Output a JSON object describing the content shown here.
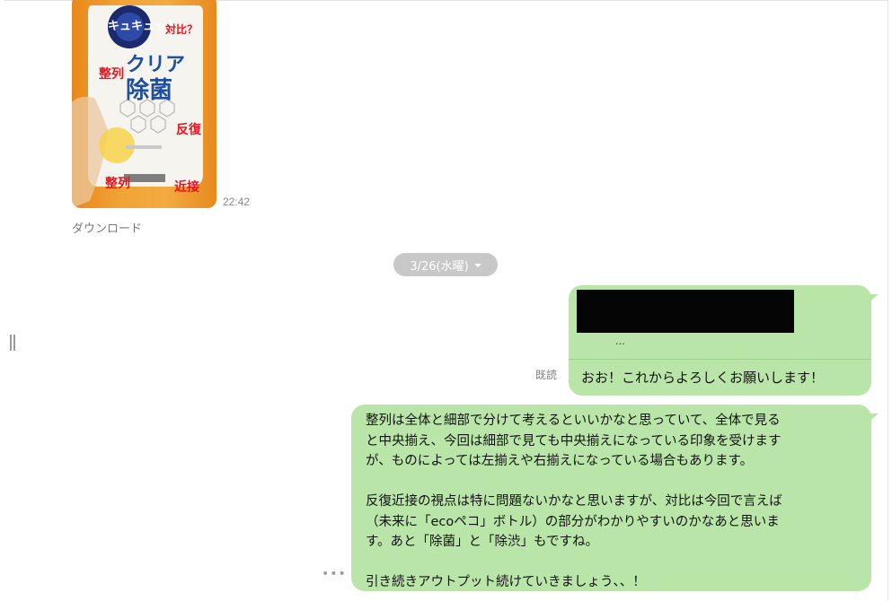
{
  "image_message": {
    "time": "22:42",
    "download_label": "ダウンロード",
    "photo_text": {
      "brand": "キュキュット",
      "label_contrast": "対比？",
      "label_align_top": "整列",
      "product_line1": "クリア",
      "product_line2": "除菌",
      "label_repeat": "反復",
      "label_align_bottom": "整列",
      "label_proximity": "近接"
    }
  },
  "date_separator": {
    "label": "3/26(水曜)"
  },
  "messages": [
    {
      "quote_ellipsis": "…",
      "read_status": "既読",
      "text": "おお！これからよろしくお願いします！"
    },
    {
      "lines": [
        "整列は全体と細部で分けて考えるといいかなと思っていて、全体で見る",
        "と中央揃え、今回は細部で見ても中央揃えになっている印象を受けます",
        "が、ものによっては左揃えや右揃えになっている場合もあります。",
        "",
        "反復近接の視点は特に問題ないかなと思いますが、対比は今回で言えば",
        "（未来に「ecoペコ」ボトル）の部分がわかりやすいのかなあと思いま",
        "す。あと「除菌」と「除渋」もですね。",
        "",
        "引き続きアウトプット続けていきましょう、、！"
      ]
    }
  ],
  "more_indicator": "•••",
  "colors": {
    "bubble": "#b9e6a8",
    "date_pill": "#c8c8c8",
    "annotation_red": "#e8141f"
  }
}
